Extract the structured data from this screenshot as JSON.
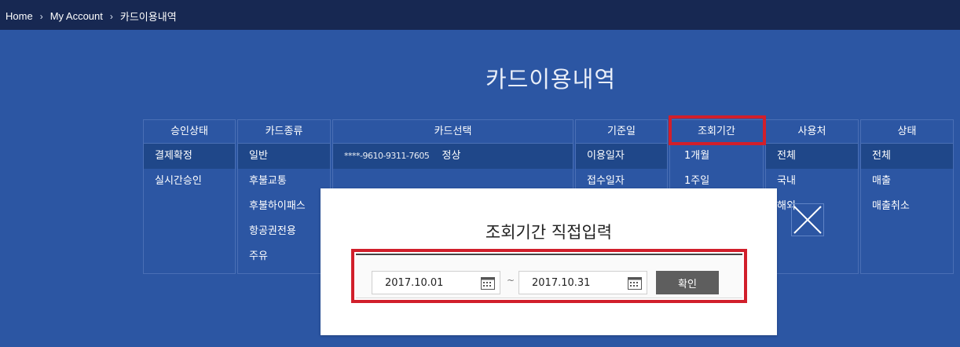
{
  "breadcrumb": {
    "items": [
      "Home",
      "My Account",
      "카드이용내역"
    ],
    "separator": "›"
  },
  "page_title": "카드이용내역",
  "filters": {
    "approval_status": {
      "header": "승인상태",
      "items": [
        "결제확정",
        "실시간승인"
      ],
      "selected": "결제확정"
    },
    "card_type": {
      "header": "카드종류",
      "items": [
        "일반",
        "후불교통",
        "후불하이패스",
        "항공권전용",
        "주유"
      ],
      "selected": "일반"
    },
    "card_select": {
      "header": "카드선택",
      "card_masked": "****-9610-9311-7605",
      "card_status": "정상",
      "selected": "****-9610-9311-7605"
    },
    "base_date": {
      "header": "기준일",
      "items": [
        "이용일자",
        "접수일자"
      ],
      "selected": "이용일자"
    },
    "period": {
      "header": "조회기간",
      "items": [
        "1개월",
        "1주일"
      ]
    },
    "usage_place": {
      "header": "사용처",
      "items": [
        "전체",
        "국내",
        "해외"
      ],
      "selected": "전체"
    },
    "status": {
      "header": "상태",
      "items": [
        "전체",
        "매출",
        "매출취소"
      ],
      "selected": "전체"
    }
  },
  "modal": {
    "title": "조회기간 직접입력",
    "start_date": "2017.10.01",
    "end_date": "2017.10.31",
    "separator": "~",
    "confirm_label": "확인"
  },
  "colors": {
    "background": "#2c56a3",
    "topbar": "#172852",
    "selected_row": "#1f4789",
    "highlight": "#d11f2b",
    "button": "#5e5e5e"
  }
}
